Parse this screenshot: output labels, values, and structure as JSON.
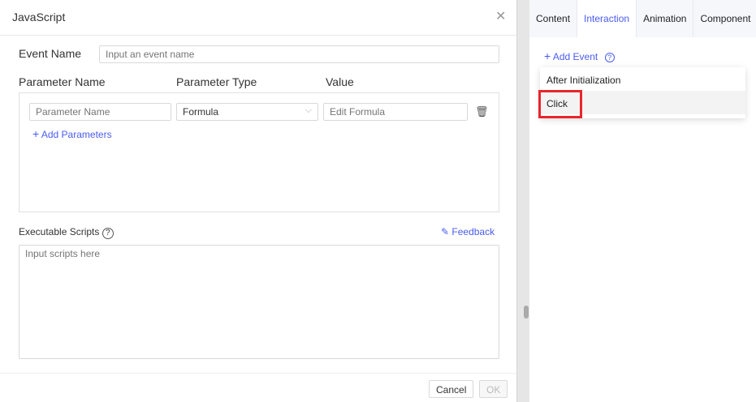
{
  "dialog": {
    "title": "JavaScript",
    "event_name_label": "Event Name",
    "event_name_placeholder": "Input an event name",
    "col_param_name": "Parameter Name",
    "col_param_type": "Parameter Type",
    "col_value": "Value",
    "param_name_placeholder": "Parameter Name",
    "param_type_value": "Formula",
    "value_placeholder": "Edit Formula",
    "add_parameters": "Add Parameters",
    "scripts_label": "Executable Scripts",
    "feedback": "Feedback",
    "scripts_placeholder": "Input scripts here",
    "cancel": "Cancel",
    "ok": "OK"
  },
  "panel": {
    "tabs": [
      "Content",
      "Interaction",
      "Animation",
      "Component"
    ],
    "active_tab": "Interaction",
    "add_event": "Add Event",
    "menu": [
      "After Initialization",
      "Click"
    ],
    "highlight_color": "#e8262d",
    "accent": "#4a5cf0"
  }
}
